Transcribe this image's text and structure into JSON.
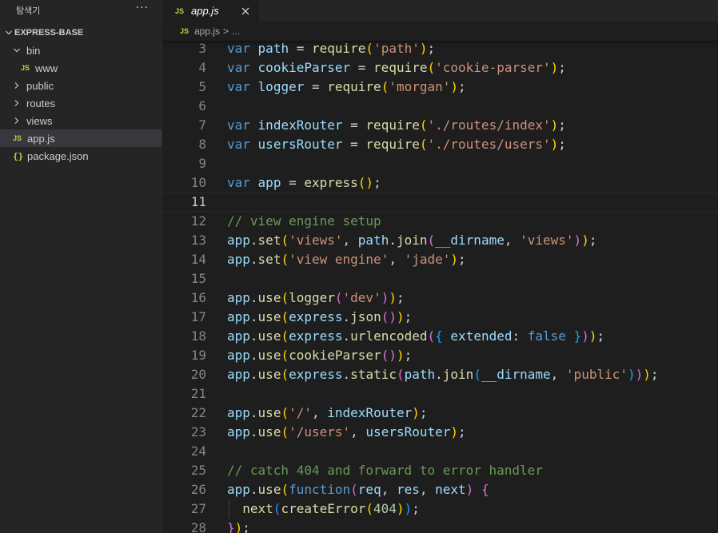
{
  "sidebar": {
    "title": "탐색기",
    "more": "···",
    "root": "EXPRESS-BASE",
    "items": [
      {
        "label": "bin",
        "kind": "folder-open"
      },
      {
        "label": "www",
        "kind": "file-js"
      },
      {
        "label": "public",
        "kind": "folder"
      },
      {
        "label": "routes",
        "kind": "folder"
      },
      {
        "label": "views",
        "kind": "folder"
      },
      {
        "label": "app.js",
        "kind": "file-js",
        "selected": true
      },
      {
        "label": "package.json",
        "kind": "file-json"
      }
    ]
  },
  "tab": {
    "badge": "JS",
    "label": "app.js"
  },
  "breadcrumb": {
    "badge": "JS",
    "file": "app.js",
    "separator": ">",
    "rest": "..."
  },
  "editor": {
    "current_line": 11,
    "lines": [
      {
        "n": "3",
        "tokens": [
          [
            "kw",
            "var"
          ],
          [
            "op",
            " "
          ],
          [
            "var",
            "path"
          ],
          [
            "op",
            " = "
          ],
          [
            "fn",
            "require"
          ],
          [
            "p1",
            "("
          ],
          [
            "str",
            "'path'"
          ],
          [
            "p1",
            ")"
          ],
          [
            "op",
            ";"
          ]
        ]
      },
      {
        "n": "4",
        "tokens": [
          [
            "kw",
            "var"
          ],
          [
            "op",
            " "
          ],
          [
            "var",
            "cookieParser"
          ],
          [
            "op",
            " = "
          ],
          [
            "fn",
            "require"
          ],
          [
            "p1",
            "("
          ],
          [
            "str",
            "'cookie-parser'"
          ],
          [
            "p1",
            ")"
          ],
          [
            "op",
            ";"
          ]
        ]
      },
      {
        "n": "5",
        "tokens": [
          [
            "kw",
            "var"
          ],
          [
            "op",
            " "
          ],
          [
            "var",
            "logger"
          ],
          [
            "op",
            " = "
          ],
          [
            "fn",
            "require"
          ],
          [
            "p1",
            "("
          ],
          [
            "str",
            "'morgan'"
          ],
          [
            "p1",
            ")"
          ],
          [
            "op",
            ";"
          ]
        ]
      },
      {
        "n": "6",
        "tokens": []
      },
      {
        "n": "7",
        "tokens": [
          [
            "kw",
            "var"
          ],
          [
            "op",
            " "
          ],
          [
            "var",
            "indexRouter"
          ],
          [
            "op",
            " = "
          ],
          [
            "fn",
            "require"
          ],
          [
            "p1",
            "("
          ],
          [
            "str",
            "'./routes/index'"
          ],
          [
            "p1",
            ")"
          ],
          [
            "op",
            ";"
          ]
        ]
      },
      {
        "n": "8",
        "tokens": [
          [
            "kw",
            "var"
          ],
          [
            "op",
            " "
          ],
          [
            "var",
            "usersRouter"
          ],
          [
            "op",
            " = "
          ],
          [
            "fn",
            "require"
          ],
          [
            "p1",
            "("
          ],
          [
            "str",
            "'./routes/users'"
          ],
          [
            "p1",
            ")"
          ],
          [
            "op",
            ";"
          ]
        ]
      },
      {
        "n": "9",
        "tokens": []
      },
      {
        "n": "10",
        "tokens": [
          [
            "kw",
            "var"
          ],
          [
            "op",
            " "
          ],
          [
            "var",
            "app"
          ],
          [
            "op",
            " = "
          ],
          [
            "fn",
            "express"
          ],
          [
            "p1",
            "()"
          ],
          [
            "op",
            ";"
          ]
        ]
      },
      {
        "n": "11",
        "tokens": []
      },
      {
        "n": "12",
        "tokens": [
          [
            "cm",
            "// view engine setup"
          ]
        ]
      },
      {
        "n": "13",
        "tokens": [
          [
            "var",
            "app"
          ],
          [
            "op",
            "."
          ],
          [
            "fn",
            "set"
          ],
          [
            "p1",
            "("
          ],
          [
            "str",
            "'views'"
          ],
          [
            "op",
            ", "
          ],
          [
            "var",
            "path"
          ],
          [
            "op",
            "."
          ],
          [
            "fn",
            "join"
          ],
          [
            "p2",
            "("
          ],
          [
            "var",
            "__dirname"
          ],
          [
            "op",
            ", "
          ],
          [
            "str",
            "'views'"
          ],
          [
            "p2",
            ")"
          ],
          [
            "p1",
            ")"
          ],
          [
            "op",
            ";"
          ]
        ]
      },
      {
        "n": "14",
        "tokens": [
          [
            "var",
            "app"
          ],
          [
            "op",
            "."
          ],
          [
            "fn",
            "set"
          ],
          [
            "p1",
            "("
          ],
          [
            "str",
            "'view engine'"
          ],
          [
            "op",
            ", "
          ],
          [
            "str",
            "'jade'"
          ],
          [
            "p1",
            ")"
          ],
          [
            "op",
            ";"
          ]
        ]
      },
      {
        "n": "15",
        "tokens": []
      },
      {
        "n": "16",
        "tokens": [
          [
            "var",
            "app"
          ],
          [
            "op",
            "."
          ],
          [
            "fn",
            "use"
          ],
          [
            "p1",
            "("
          ],
          [
            "fn",
            "logger"
          ],
          [
            "p2",
            "("
          ],
          [
            "str",
            "'dev'"
          ],
          [
            "p2",
            ")"
          ],
          [
            "p1",
            ")"
          ],
          [
            "op",
            ";"
          ]
        ]
      },
      {
        "n": "17",
        "tokens": [
          [
            "var",
            "app"
          ],
          [
            "op",
            "."
          ],
          [
            "fn",
            "use"
          ],
          [
            "p1",
            "("
          ],
          [
            "var",
            "express"
          ],
          [
            "op",
            "."
          ],
          [
            "fn",
            "json"
          ],
          [
            "p2",
            "()"
          ],
          [
            "p1",
            ")"
          ],
          [
            "op",
            ";"
          ]
        ]
      },
      {
        "n": "18",
        "tokens": [
          [
            "var",
            "app"
          ],
          [
            "op",
            "."
          ],
          [
            "fn",
            "use"
          ],
          [
            "p1",
            "("
          ],
          [
            "var",
            "express"
          ],
          [
            "op",
            "."
          ],
          [
            "fn",
            "urlencoded"
          ],
          [
            "p2",
            "("
          ],
          [
            "p3",
            "{"
          ],
          [
            "op",
            " "
          ],
          [
            "var",
            "extended"
          ],
          [
            "op",
            ": "
          ],
          [
            "kw",
            "false"
          ],
          [
            "op",
            " "
          ],
          [
            "p3",
            "}"
          ],
          [
            "p2",
            ")"
          ],
          [
            "p1",
            ")"
          ],
          [
            "op",
            ";"
          ]
        ]
      },
      {
        "n": "19",
        "tokens": [
          [
            "var",
            "app"
          ],
          [
            "op",
            "."
          ],
          [
            "fn",
            "use"
          ],
          [
            "p1",
            "("
          ],
          [
            "fn",
            "cookieParser"
          ],
          [
            "p2",
            "()"
          ],
          [
            "p1",
            ")"
          ],
          [
            "op",
            ";"
          ]
        ]
      },
      {
        "n": "20",
        "tokens": [
          [
            "var",
            "app"
          ],
          [
            "op",
            "."
          ],
          [
            "fn",
            "use"
          ],
          [
            "p1",
            "("
          ],
          [
            "var",
            "express"
          ],
          [
            "op",
            "."
          ],
          [
            "fn",
            "static"
          ],
          [
            "p2",
            "("
          ],
          [
            "var",
            "path"
          ],
          [
            "op",
            "."
          ],
          [
            "fn",
            "join"
          ],
          [
            "p3",
            "("
          ],
          [
            "var",
            "__dirname"
          ],
          [
            "op",
            ", "
          ],
          [
            "str",
            "'public'"
          ],
          [
            "p3",
            ")"
          ],
          [
            "p2",
            ")"
          ],
          [
            "p1",
            ")"
          ],
          [
            "op",
            ";"
          ]
        ]
      },
      {
        "n": "21",
        "tokens": []
      },
      {
        "n": "22",
        "tokens": [
          [
            "var",
            "app"
          ],
          [
            "op",
            "."
          ],
          [
            "fn",
            "use"
          ],
          [
            "p1",
            "("
          ],
          [
            "str",
            "'/'"
          ],
          [
            "op",
            ", "
          ],
          [
            "var",
            "indexRouter"
          ],
          [
            "p1",
            ")"
          ],
          [
            "op",
            ";"
          ]
        ]
      },
      {
        "n": "23",
        "tokens": [
          [
            "var",
            "app"
          ],
          [
            "op",
            "."
          ],
          [
            "fn",
            "use"
          ],
          [
            "p1",
            "("
          ],
          [
            "str",
            "'/users'"
          ],
          [
            "op",
            ", "
          ],
          [
            "var",
            "usersRouter"
          ],
          [
            "p1",
            ")"
          ],
          [
            "op",
            ";"
          ]
        ]
      },
      {
        "n": "24",
        "tokens": []
      },
      {
        "n": "25",
        "tokens": [
          [
            "cm",
            "// catch 404 and forward to error handler"
          ]
        ]
      },
      {
        "n": "26",
        "tokens": [
          [
            "var",
            "app"
          ],
          [
            "op",
            "."
          ],
          [
            "fn",
            "use"
          ],
          [
            "p1",
            "("
          ],
          [
            "kw",
            "function"
          ],
          [
            "p2",
            "("
          ],
          [
            "var",
            "req"
          ],
          [
            "op",
            ", "
          ],
          [
            "var",
            "res"
          ],
          [
            "op",
            ", "
          ],
          [
            "var",
            "next"
          ],
          [
            "p2",
            ")"
          ],
          [
            "op",
            " "
          ],
          [
            "p2",
            "{"
          ]
        ]
      },
      {
        "n": "27",
        "indent": true,
        "tokens": [
          [
            "op",
            "  "
          ],
          [
            "fn",
            "next"
          ],
          [
            "p3",
            "("
          ],
          [
            "fn",
            "createError"
          ],
          [
            "p1",
            "("
          ],
          [
            "num",
            "404"
          ],
          [
            "p1",
            ")"
          ],
          [
            "p3",
            ")"
          ],
          [
            "op",
            ";"
          ]
        ]
      },
      {
        "n": "28",
        "tokens": [
          [
            "p2",
            "}"
          ],
          [
            "p1",
            ")"
          ],
          [
            "op",
            ";"
          ]
        ]
      }
    ]
  }
}
